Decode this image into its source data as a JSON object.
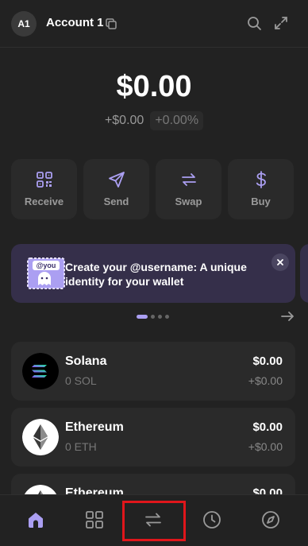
{
  "header": {
    "avatar_initials": "A1",
    "account_name": "Account 1",
    "icons": [
      "copy-icon",
      "search-icon",
      "expand-icon"
    ]
  },
  "balance": {
    "total": "$0.00",
    "change_usd": "+$0.00",
    "change_pct": "+0.00%"
  },
  "actions": [
    {
      "label": "Receive",
      "icon": "qr-code-icon"
    },
    {
      "label": "Send",
      "icon": "send-icon"
    },
    {
      "label": "Swap",
      "icon": "swap-icon"
    },
    {
      "label": "Buy",
      "icon": "dollar-icon"
    }
  ],
  "banner": {
    "badge": "@you",
    "text": "Create your @username: A unique identity for your wallet",
    "pager": {
      "count": 4,
      "active": 0
    }
  },
  "tokens": [
    {
      "name": "Solana",
      "amount": "0 SOL",
      "value": "$0.00",
      "change": "+$0.00"
    },
    {
      "name": "Ethereum",
      "amount": "0 ETH",
      "value": "$0.00",
      "change": "+$0.00"
    },
    {
      "name": "Ethereum",
      "amount": "",
      "value": "$0.00",
      "change": ""
    }
  ],
  "bottom_nav": [
    {
      "icon": "home-icon",
      "active": true
    },
    {
      "icon": "grid-icon",
      "active": false
    },
    {
      "icon": "swap-icon",
      "active": false,
      "highlighted": true
    },
    {
      "icon": "history-icon",
      "active": false
    },
    {
      "icon": "compass-icon",
      "active": false
    }
  ],
  "colors": {
    "background": "#222222",
    "card": "#2a2a2a",
    "accent": "#ab9ff2",
    "banner": "#352f4a",
    "highlight": "#e0161b"
  }
}
